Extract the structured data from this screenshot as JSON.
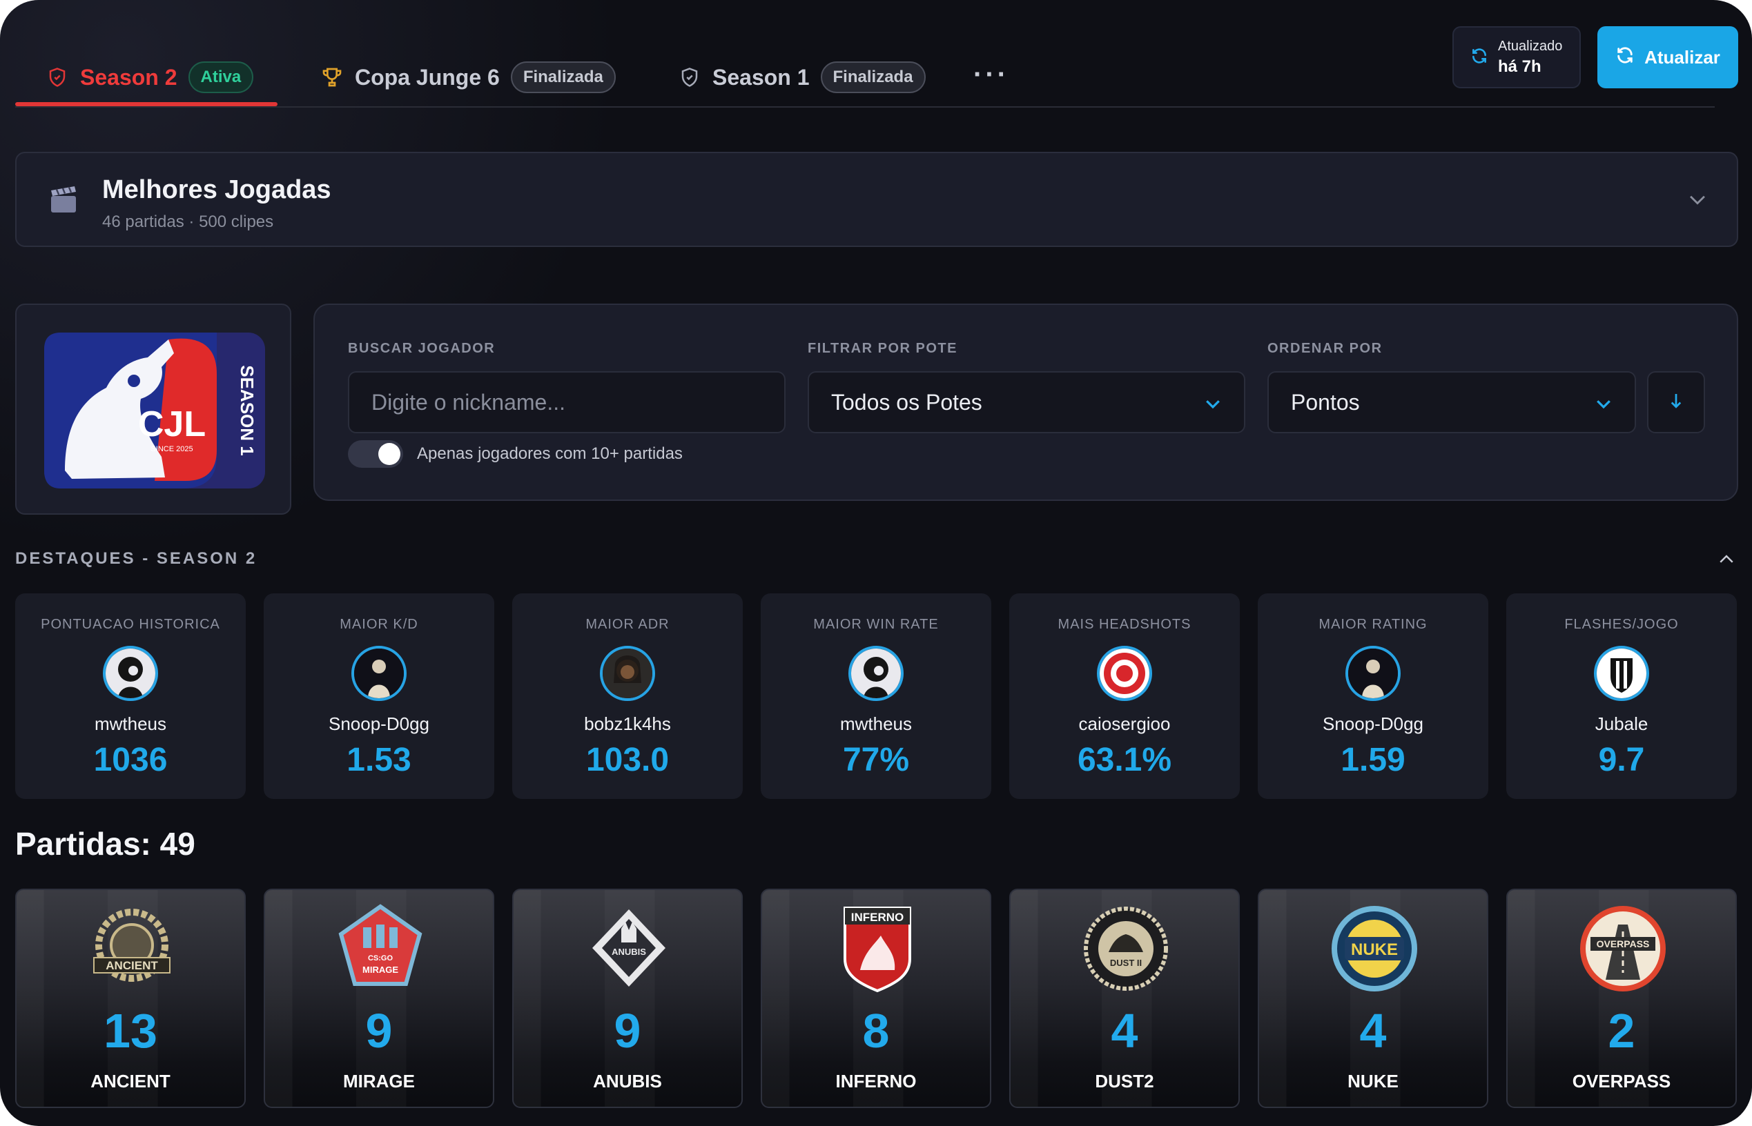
{
  "tabs": [
    {
      "label": "Season 2",
      "badge": "Ativa"
    },
    {
      "label": "Copa Junge 6",
      "badge": "Finalizada"
    },
    {
      "label": "Season 1",
      "badge": "Finalizada"
    }
  ],
  "tabs_more": "···",
  "updated": {
    "line1": "Atualizado",
    "line2": "há 7h"
  },
  "refresh_label": "Atualizar",
  "best_plays": {
    "title": "Melhores Jogadas",
    "subtitle": "46 partidas · 500 clipes"
  },
  "logo": {
    "text": "CJL",
    "since": "SINCE 2025",
    "season": "SEASON 1"
  },
  "filters": {
    "search_label": "BUSCAR JOGADOR",
    "search_placeholder": "Digite o nickname...",
    "pote_label": "FILTRAR POR POTE",
    "pote_value": "Todos os Potes",
    "order_label": "ORDENAR POR",
    "order_value": "Pontos",
    "toggle_label": "Apenas jogadores com 10+ partidas",
    "toggle_on": true
  },
  "highlights_title": "DESTAQUES - SEASON 2",
  "highlights": [
    {
      "label": "PONTUACAO HISTORICA",
      "player": "mwtheus",
      "value": "1036"
    },
    {
      "label": "MAIOR K/D",
      "player": "Snoop-D0gg",
      "value": "1.53"
    },
    {
      "label": "MAIOR ADR",
      "player": "bobz1k4hs",
      "value": "103.0"
    },
    {
      "label": "MAIOR WIN RATE",
      "player": "mwtheus",
      "value": "77%"
    },
    {
      "label": "MAIS HEADSHOTS",
      "player": "caiosergioo",
      "value": "63.1%"
    },
    {
      "label": "MAIOR RATING",
      "player": "Snoop-D0gg",
      "value": "1.59"
    },
    {
      "label": "FLASHES/JOGO",
      "player": "Jubale",
      "value": "9.7"
    }
  ],
  "matches_title": "Partidas: 49",
  "maps": [
    {
      "name": "ANCIENT",
      "count": "13"
    },
    {
      "name": "MIRAGE",
      "count": "9"
    },
    {
      "name": "ANUBIS",
      "count": "9"
    },
    {
      "name": "INFERNO",
      "count": "8"
    },
    {
      "name": "DUST2",
      "count": "4"
    },
    {
      "name": "NUKE",
      "count": "4"
    },
    {
      "name": "OVERPASS",
      "count": "2"
    }
  ],
  "map_logo_texts": {
    "ancient": "ANCIENT",
    "mirage": "MIRAGE",
    "inferno": "INFERNO",
    "dust2": "DUST II",
    "nuke": "NUKE",
    "overpass": "OVERPASS",
    "anubis": "ANUBIS"
  },
  "colors": {
    "accent": "#1aa6e6",
    "active_tab": "#e23636",
    "value": "#20a9ea",
    "bg": "#0e0f15",
    "card": "#1b1d2a"
  }
}
